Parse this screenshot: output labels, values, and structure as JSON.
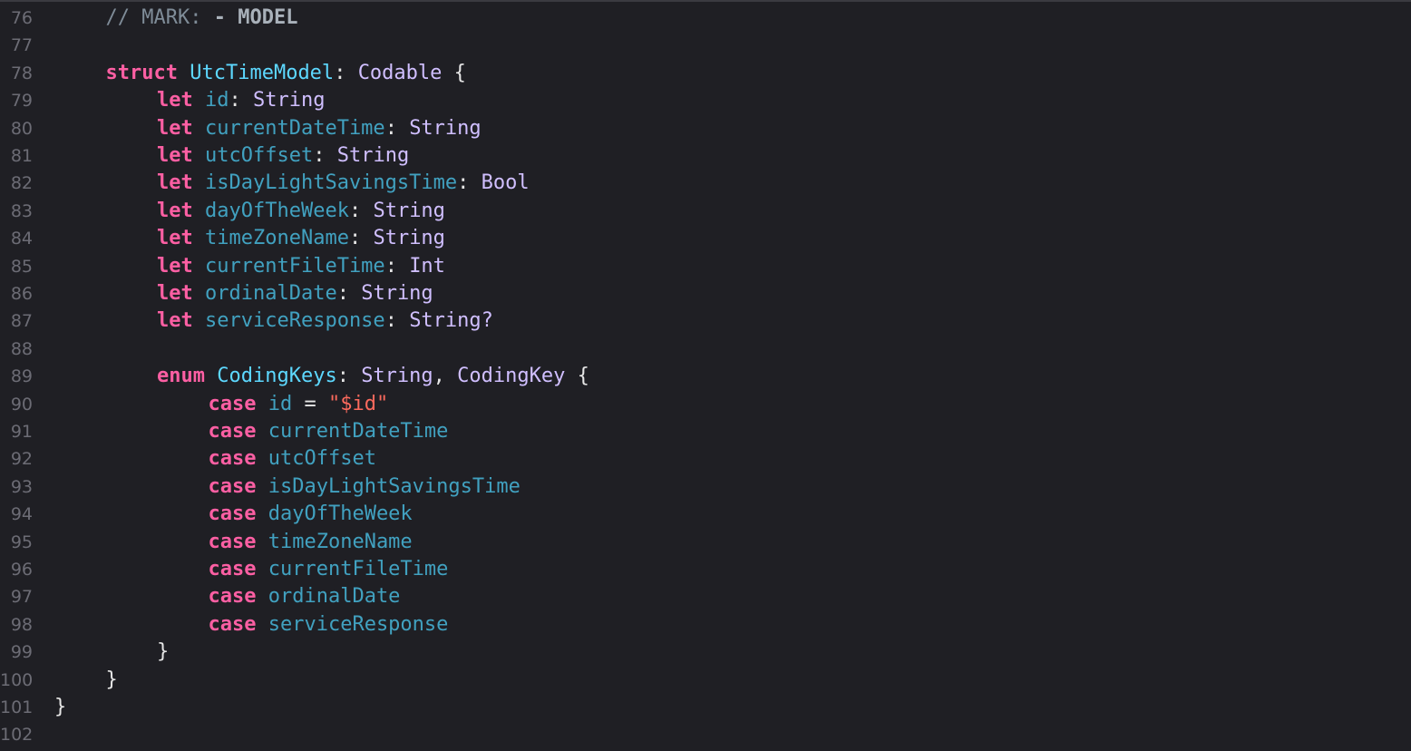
{
  "editor": {
    "language": "Swift",
    "colors": {
      "background": "#1f1f24",
      "line_number": "#6c6c75",
      "keyword": "#fc5fa3",
      "type_declaration": "#5dd8ff",
      "type": "#d0bfff",
      "property": "#41a1c0",
      "plain": "#e6e6e6",
      "string": "#fc6a5d",
      "comment": "#7f8c98"
    },
    "lines": [
      {
        "num": "76",
        "indent": 1,
        "tokens": [
          {
            "t": "// MARK: ",
            "k": "comment"
          },
          {
            "t": "- MODEL",
            "k": "mark"
          }
        ]
      },
      {
        "num": "77",
        "indent": 0,
        "tokens": []
      },
      {
        "num": "78",
        "indent": 1,
        "tokens": [
          {
            "t": "struct",
            "k": "keyword"
          },
          {
            "t": " ",
            "k": "plain"
          },
          {
            "t": "UtcTimeModel",
            "k": "typedecl"
          },
          {
            "t": ": ",
            "k": "plain"
          },
          {
            "t": "Codable",
            "k": "type"
          },
          {
            "t": " {",
            "k": "plain"
          }
        ]
      },
      {
        "num": "79",
        "indent": 2,
        "tokens": [
          {
            "t": "let",
            "k": "keyword"
          },
          {
            "t": " ",
            "k": "plain"
          },
          {
            "t": "id",
            "k": "prop"
          },
          {
            "t": ": ",
            "k": "plain"
          },
          {
            "t": "String",
            "k": "type"
          }
        ]
      },
      {
        "num": "80",
        "indent": 2,
        "tokens": [
          {
            "t": "let",
            "k": "keyword"
          },
          {
            "t": " ",
            "k": "plain"
          },
          {
            "t": "currentDateTime",
            "k": "prop"
          },
          {
            "t": ": ",
            "k": "plain"
          },
          {
            "t": "String",
            "k": "type"
          }
        ]
      },
      {
        "num": "81",
        "indent": 2,
        "tokens": [
          {
            "t": "let",
            "k": "keyword"
          },
          {
            "t": " ",
            "k": "plain"
          },
          {
            "t": "utcOffset",
            "k": "prop"
          },
          {
            "t": ": ",
            "k": "plain"
          },
          {
            "t": "String",
            "k": "type"
          }
        ]
      },
      {
        "num": "82",
        "indent": 2,
        "tokens": [
          {
            "t": "let",
            "k": "keyword"
          },
          {
            "t": " ",
            "k": "plain"
          },
          {
            "t": "isDayLightSavingsTime",
            "k": "prop"
          },
          {
            "t": ": ",
            "k": "plain"
          },
          {
            "t": "Bool",
            "k": "type"
          }
        ]
      },
      {
        "num": "83",
        "indent": 2,
        "tokens": [
          {
            "t": "let",
            "k": "keyword"
          },
          {
            "t": " ",
            "k": "plain"
          },
          {
            "t": "dayOfTheWeek",
            "k": "prop"
          },
          {
            "t": ": ",
            "k": "plain"
          },
          {
            "t": "String",
            "k": "type"
          }
        ]
      },
      {
        "num": "84",
        "indent": 2,
        "tokens": [
          {
            "t": "let",
            "k": "keyword"
          },
          {
            "t": " ",
            "k": "plain"
          },
          {
            "t": "timeZoneName",
            "k": "prop"
          },
          {
            "t": ": ",
            "k": "plain"
          },
          {
            "t": "String",
            "k": "type"
          }
        ]
      },
      {
        "num": "85",
        "indent": 2,
        "tokens": [
          {
            "t": "let",
            "k": "keyword"
          },
          {
            "t": " ",
            "k": "plain"
          },
          {
            "t": "currentFileTime",
            "k": "prop"
          },
          {
            "t": ": ",
            "k": "plain"
          },
          {
            "t": "Int",
            "k": "type"
          }
        ]
      },
      {
        "num": "86",
        "indent": 2,
        "tokens": [
          {
            "t": "let",
            "k": "keyword"
          },
          {
            "t": " ",
            "k": "plain"
          },
          {
            "t": "ordinalDate",
            "k": "prop"
          },
          {
            "t": ": ",
            "k": "plain"
          },
          {
            "t": "String",
            "k": "type"
          }
        ]
      },
      {
        "num": "87",
        "indent": 2,
        "tokens": [
          {
            "t": "let",
            "k": "keyword"
          },
          {
            "t": " ",
            "k": "plain"
          },
          {
            "t": "serviceResponse",
            "k": "prop"
          },
          {
            "t": ": ",
            "k": "plain"
          },
          {
            "t": "String?",
            "k": "type"
          }
        ]
      },
      {
        "num": "88",
        "indent": 0,
        "tokens": []
      },
      {
        "num": "89",
        "indent": 2,
        "tokens": [
          {
            "t": "enum",
            "k": "keyword"
          },
          {
            "t": " ",
            "k": "plain"
          },
          {
            "t": "CodingKeys",
            "k": "typedecl"
          },
          {
            "t": ": ",
            "k": "plain"
          },
          {
            "t": "String",
            "k": "type"
          },
          {
            "t": ", ",
            "k": "plain"
          },
          {
            "t": "CodingKey",
            "k": "type"
          },
          {
            "t": " {",
            "k": "plain"
          }
        ]
      },
      {
        "num": "90",
        "indent": 3,
        "tokens": [
          {
            "t": "case",
            "k": "keyword"
          },
          {
            "t": " ",
            "k": "plain"
          },
          {
            "t": "id",
            "k": "prop"
          },
          {
            "t": " = ",
            "k": "plain"
          },
          {
            "t": "\"$id\"",
            "k": "string"
          }
        ]
      },
      {
        "num": "91",
        "indent": 3,
        "tokens": [
          {
            "t": "case",
            "k": "keyword"
          },
          {
            "t": " ",
            "k": "plain"
          },
          {
            "t": "currentDateTime",
            "k": "prop"
          }
        ]
      },
      {
        "num": "92",
        "indent": 3,
        "tokens": [
          {
            "t": "case",
            "k": "keyword"
          },
          {
            "t": " ",
            "k": "plain"
          },
          {
            "t": "utcOffset",
            "k": "prop"
          }
        ]
      },
      {
        "num": "93",
        "indent": 3,
        "tokens": [
          {
            "t": "case",
            "k": "keyword"
          },
          {
            "t": " ",
            "k": "plain"
          },
          {
            "t": "isDayLightSavingsTime",
            "k": "prop"
          }
        ]
      },
      {
        "num": "94",
        "indent": 3,
        "tokens": [
          {
            "t": "case",
            "k": "keyword"
          },
          {
            "t": " ",
            "k": "plain"
          },
          {
            "t": "dayOfTheWeek",
            "k": "prop"
          }
        ]
      },
      {
        "num": "95",
        "indent": 3,
        "tokens": [
          {
            "t": "case",
            "k": "keyword"
          },
          {
            "t": " ",
            "k": "plain"
          },
          {
            "t": "timeZoneName",
            "k": "prop"
          }
        ]
      },
      {
        "num": "96",
        "indent": 3,
        "tokens": [
          {
            "t": "case",
            "k": "keyword"
          },
          {
            "t": " ",
            "k": "plain"
          },
          {
            "t": "currentFileTime",
            "k": "prop"
          }
        ]
      },
      {
        "num": "97",
        "indent": 3,
        "tokens": [
          {
            "t": "case",
            "k": "keyword"
          },
          {
            "t": " ",
            "k": "plain"
          },
          {
            "t": "ordinalDate",
            "k": "prop"
          }
        ]
      },
      {
        "num": "98",
        "indent": 3,
        "tokens": [
          {
            "t": "case",
            "k": "keyword"
          },
          {
            "t": " ",
            "k": "plain"
          },
          {
            "t": "serviceResponse",
            "k": "prop"
          }
        ]
      },
      {
        "num": "99",
        "indent": 2,
        "tokens": [
          {
            "t": "}",
            "k": "plain"
          }
        ]
      },
      {
        "num": "100",
        "indent": 1,
        "tokens": [
          {
            "t": "}",
            "k": "plain"
          }
        ]
      },
      {
        "num": "101",
        "indent": 0,
        "tokens": [
          {
            "t": "}",
            "k": "plain"
          }
        ]
      },
      {
        "num": "102",
        "indent": 0,
        "tokens": []
      }
    ]
  }
}
